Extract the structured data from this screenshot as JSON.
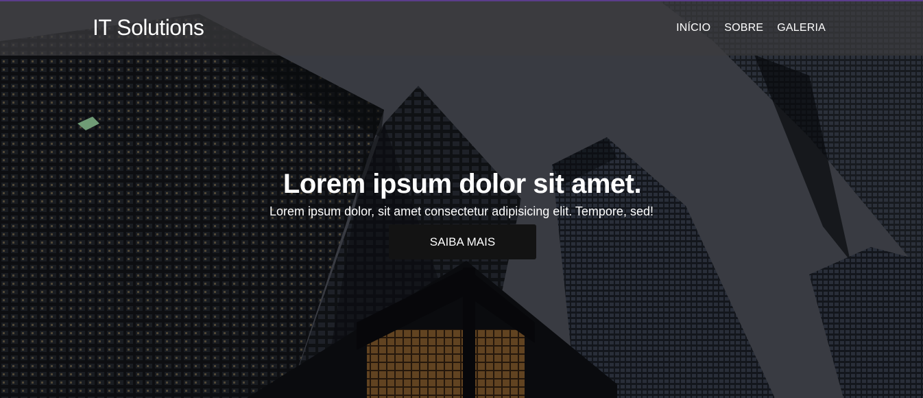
{
  "header": {
    "brand": "IT Solutions",
    "nav_items": [
      "INÍCIO",
      "SOBRE",
      "GALERIA"
    ]
  },
  "hero": {
    "title": "Lorem ipsum dolor sit amet.",
    "subtitle": "Lorem ipsum dolor, sit amet consectetur adipisicing elit. Tempore, sed!",
    "cta_label": "SAIBA MAIS"
  },
  "colors": {
    "navbar_bg": "#3c3c3e",
    "cta_bg": "#131313",
    "text": "#ffffff",
    "top_accent": "#5b3d8c"
  }
}
